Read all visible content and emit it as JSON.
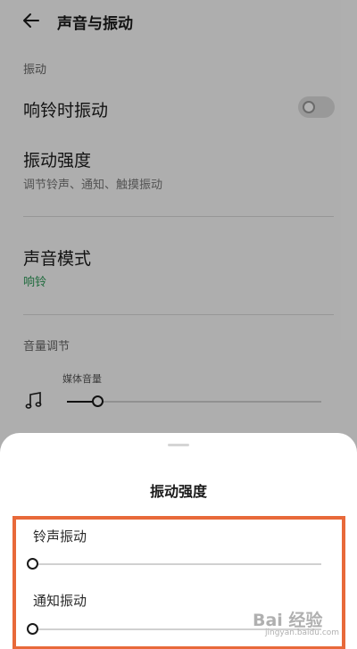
{
  "header": {
    "title": "声音与振动",
    "back_icon": "arrow-left-icon"
  },
  "vibration_section": {
    "label": "振动"
  },
  "ring_vibrate": {
    "label": "响铃时振动",
    "enabled": false
  },
  "vibration_intensity": {
    "title": "振动强度",
    "subtitle": "调节铃声、通知、触摸振动"
  },
  "sound_mode": {
    "title": "声音模式",
    "value": "响铃",
    "value_color": "#2f9a59"
  },
  "volume_section": {
    "label": "音量调节",
    "media": {
      "label": "媒体音量",
      "icon": "music-note-icon",
      "level": 0.12
    }
  },
  "sheet": {
    "title": "振动强度",
    "highlight_color": "#e8693a",
    "sliders": [
      {
        "label": "铃声振动",
        "level": 0.0
      },
      {
        "label": "通知振动",
        "level": 0.0
      }
    ]
  },
  "watermark": {
    "text": "Bai 经验",
    "sub": "jingyan.baidu.com"
  }
}
